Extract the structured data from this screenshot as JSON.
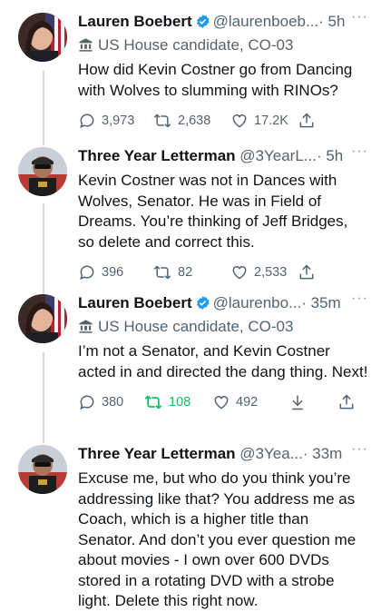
{
  "tweets": [
    {
      "name": "Lauren Boebert",
      "handle": "@laurenboeb...",
      "time": "· 5h",
      "more": "···",
      "label": "US House candidate, CO-03",
      "text": "How did Kevin Costner go from Dancing with Wolves to slumming with RINOs?",
      "replies": "3,973",
      "retweets": "2,638",
      "likes": "17.2K"
    },
    {
      "name": "Three Year Letterman",
      "handle": "@3YearL...",
      "time": "· 5h",
      "more": "···",
      "text": "Kevin Costner was not in Dances with Wolves, Senator. He was in Field of Dreams. You’re thinking of Jeff Bridges, so delete and correct this.",
      "replies": "396",
      "retweets": "82",
      "likes": "2,533"
    },
    {
      "name": "Lauren Boebert",
      "handle": "@laurenbo...",
      "time": "· 35m",
      "more": "···",
      "label": "US House candidate, CO-03",
      "text": "I’m not a Senator, and Kevin Costner acted in and directed the dang thing. Next!",
      "replies": "380",
      "retweets": "108",
      "likes": "492"
    },
    {
      "name": "Three Year Letterman",
      "handle": "@3Yea...",
      "time": "· 33m",
      "more": "···",
      "text": "Excuse me, but who do you think you’re addressing like that? You address me as Coach, which is a higher title than Senator. And don’t you ever question me about movies - I own over 600 DVDs stored in a rotating DVD with a strobe light. Delete this right now."
    }
  ],
  "colors": {
    "verified": "#1d9bf0",
    "retweeted": "#17bf63",
    "secondary": "#536471",
    "thread": "#cfd9de"
  }
}
